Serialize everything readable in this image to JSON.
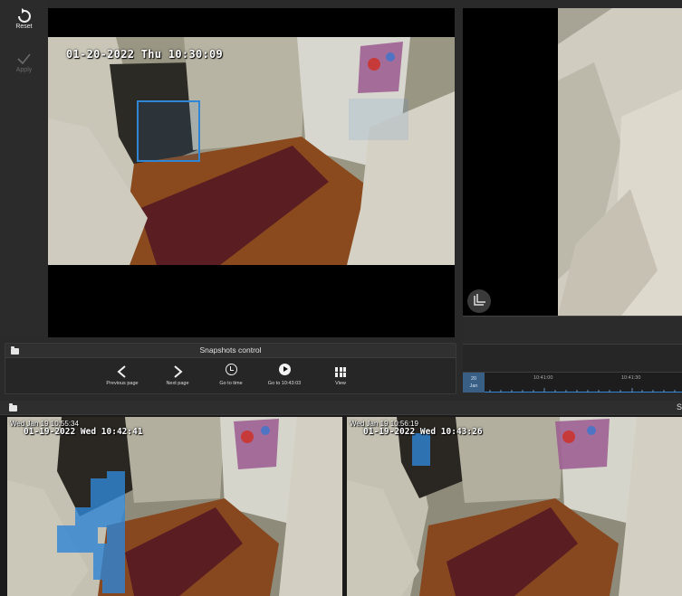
{
  "toolbar": {
    "reset_label": "Reset",
    "apply_label": "Apply",
    "reset_icon": "undo-arrow-icon",
    "apply_icon": "checkmark-icon"
  },
  "main_view": {
    "timestamp": "01-20-2022 Thu 10:30:09"
  },
  "right_view": {
    "layers_icon": "layers-icon"
  },
  "timeline": {
    "date_day": "20",
    "date_month": "Jan",
    "labels": [
      "10:41:00",
      "10:41:30"
    ]
  },
  "snapshots_control": {
    "title": "Snapshots control",
    "buttons": [
      {
        "label": "Previous page",
        "icon": "chevron-left-icon"
      },
      {
        "label": "Next page",
        "icon": "chevron-right-icon"
      },
      {
        "label": "Go to time",
        "icon": "clock-icon"
      },
      {
        "label": "Go to 10:43:03",
        "icon": "play-circle-icon"
      },
      {
        "label": "View",
        "icon": "grid-icon"
      }
    ]
  },
  "bottom_panel": {
    "title": "S"
  },
  "snapshots": [
    {
      "time_label": "Wed Jan 19 10:55:34",
      "osd": "01-19-2022 Wed 10:42:41"
    },
    {
      "time_label": "Wed Jan 19 10:56:19",
      "osd": "01-19-2022 Wed 10:43:26"
    }
  ],
  "colors": {
    "accent": "#2f86d6",
    "panel": "#262626",
    "background": "#2a2a2a"
  }
}
